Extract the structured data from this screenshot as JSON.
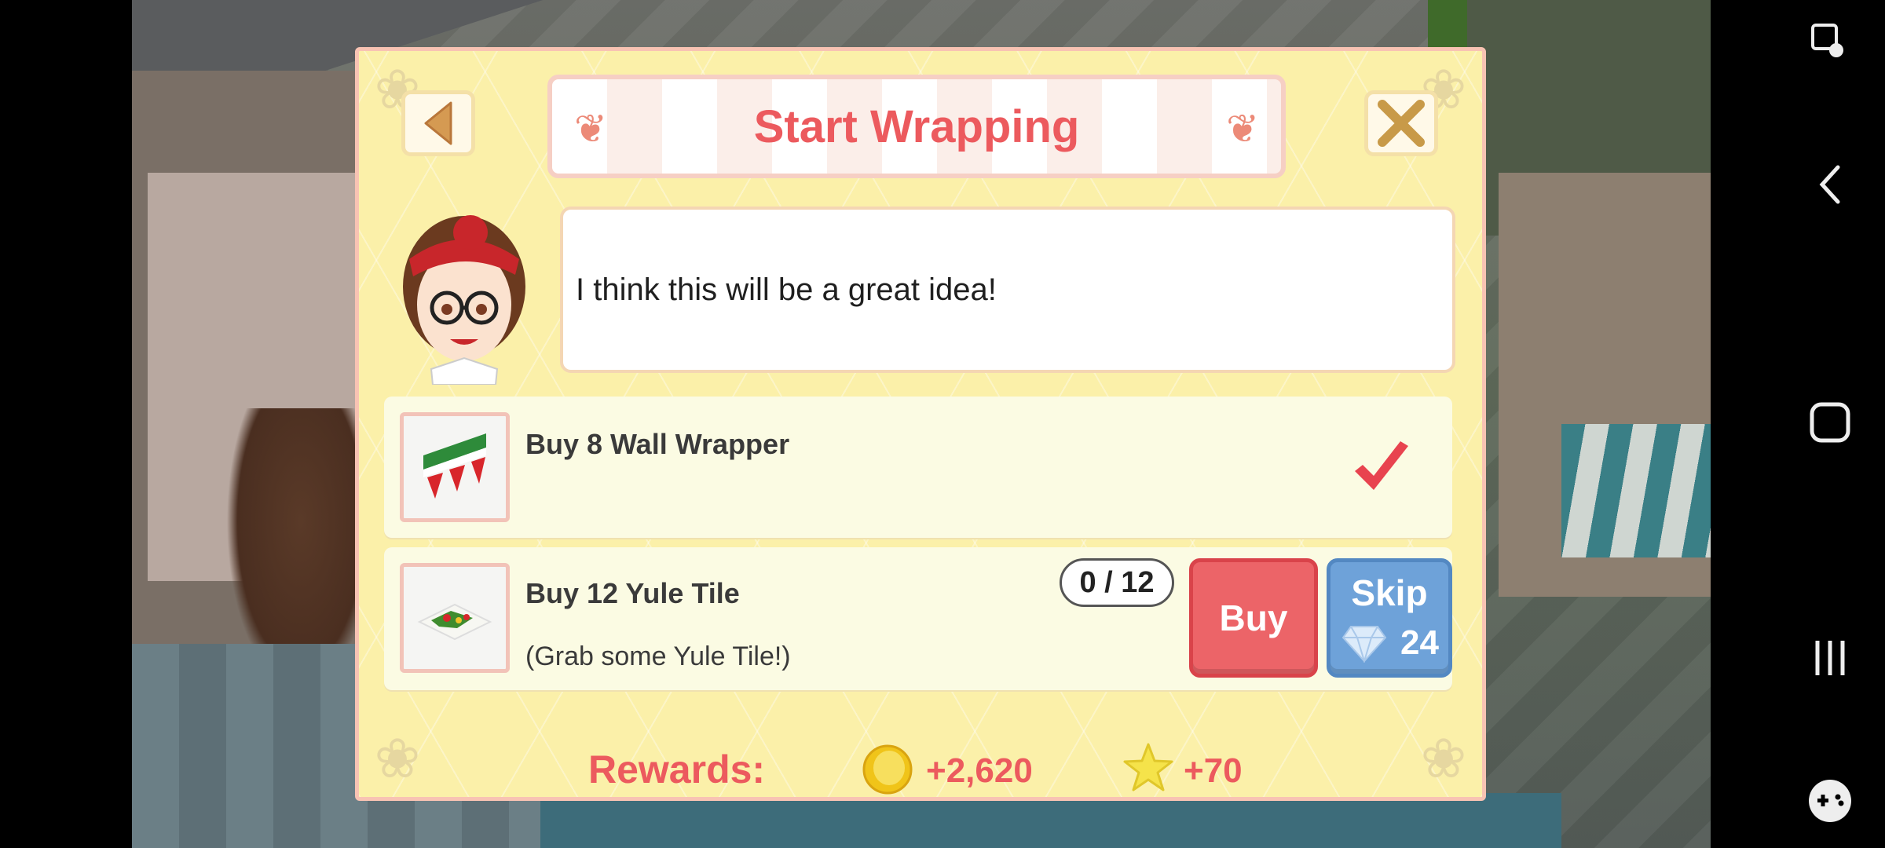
{
  "dialog": {
    "title": "Start Wrapping",
    "back_icon": "back-arrow-icon",
    "close_icon": "close-x-icon",
    "message": "I think this will be a great idea!"
  },
  "tasks": [
    {
      "title": "Buy 8 Wall Wrapper",
      "icon": "wall-wrapper-icon",
      "completed": true,
      "status_icon": "checkmark-icon"
    },
    {
      "title": "Buy 12 Yule Tile",
      "subtitle": "(Grab some Yule Tile!)",
      "icon": "yule-tile-icon",
      "progress": "0 / 12",
      "progress_current": 0,
      "progress_total": 12,
      "buy_label": "Buy",
      "skip_label": "Skip",
      "skip_cost": "24",
      "skip_cost_icon": "gem-icon"
    }
  ],
  "rewards": {
    "label": "Rewards:",
    "coins": "+2,620",
    "coin_icon": "coin-icon",
    "stars": "+70",
    "star_icon": "star-icon"
  },
  "colors": {
    "title_red": "#ec5a5e",
    "panel_yellow": "#fbf0a9",
    "buy_red": "#ec6468",
    "skip_blue": "#6ea2d9",
    "check_red": "#e8434f"
  }
}
